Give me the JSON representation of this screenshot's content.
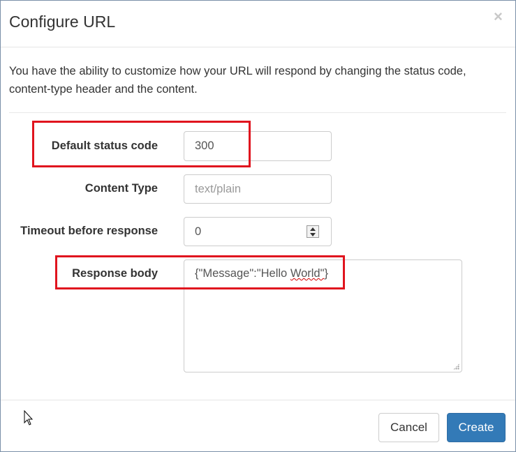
{
  "dialog": {
    "title": "Configure URL",
    "close_symbol": "×",
    "intro_text": "You have the ability to customize how your URL will respond by changing the status code, content-type header and the content."
  },
  "form": {
    "status_code": {
      "label": "Default status code",
      "value": "300"
    },
    "content_type": {
      "label": "Content Type",
      "placeholder": "text/plain"
    },
    "timeout": {
      "label": "Timeout before response",
      "value": "0"
    },
    "response_body": {
      "label": "Response body",
      "value_prefix": "{\"Message\":\"Hello ",
      "value_misspelled": "World\"",
      "value_suffix": "}"
    }
  },
  "footer": {
    "cancel_label": "Cancel",
    "create_label": "Create"
  },
  "colors": {
    "highlight_box": "#e0141e",
    "primary_button": "#337ab7"
  },
  "icons": [
    "close-icon",
    "spinner-up-icon",
    "spinner-down-icon",
    "resize-grip-icon",
    "mouse-cursor-icon"
  ]
}
